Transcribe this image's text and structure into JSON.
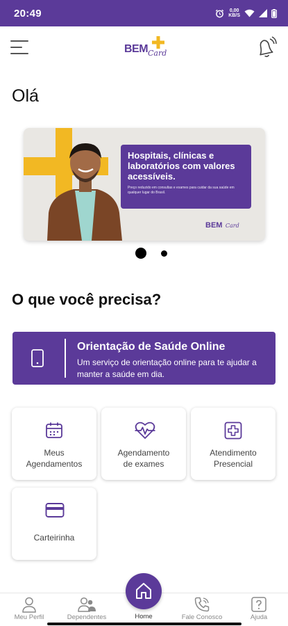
{
  "status_bar": {
    "time": "20:49",
    "network_top": "0,00",
    "network_bottom": "KB/S"
  },
  "header": {
    "logo_main": "BEM",
    "logo_sub": "Card"
  },
  "greeting": "Olá",
  "banner": {
    "headline": "Hospitais, clínicas e laboratórios com valores acessíveis.",
    "subtext": "Preço reduzido em consultas e exames para cuidar da sua saúde em qualquer lugar do Brasil.",
    "logo_main": "BEM",
    "logo_sub": "Card",
    "slide_count": 2,
    "active_slide": 1
  },
  "section_title": "O que você precisa?",
  "promo": {
    "title": "Orientação de Saúde Online",
    "description": "Um serviço de orientação online para te ajudar a manter a saúde em dia.",
    "icon": "smartphone-icon"
  },
  "services": [
    {
      "label_line1": "Meus",
      "label_line2": "Agendamentos",
      "icon": "calendar-icon"
    },
    {
      "label_line1": "Agendamento",
      "label_line2": "de exames",
      "icon": "heart-pulse-icon"
    },
    {
      "label_line1": "Atendimento",
      "label_line2": "Presencial",
      "icon": "medical-cross-icon"
    },
    {
      "label_line1": "Carteirinha",
      "icon": "card-icon"
    }
  ],
  "bottom_nav": {
    "profile": "Meu Perfil",
    "dependents": "Dependentes",
    "home": "Home",
    "contact": "Fale Conosco",
    "help": "Ajuda",
    "active": "Home"
  },
  "colors": {
    "brand_purple": "#5b3a99",
    "brand_yellow": "#f2b823"
  }
}
